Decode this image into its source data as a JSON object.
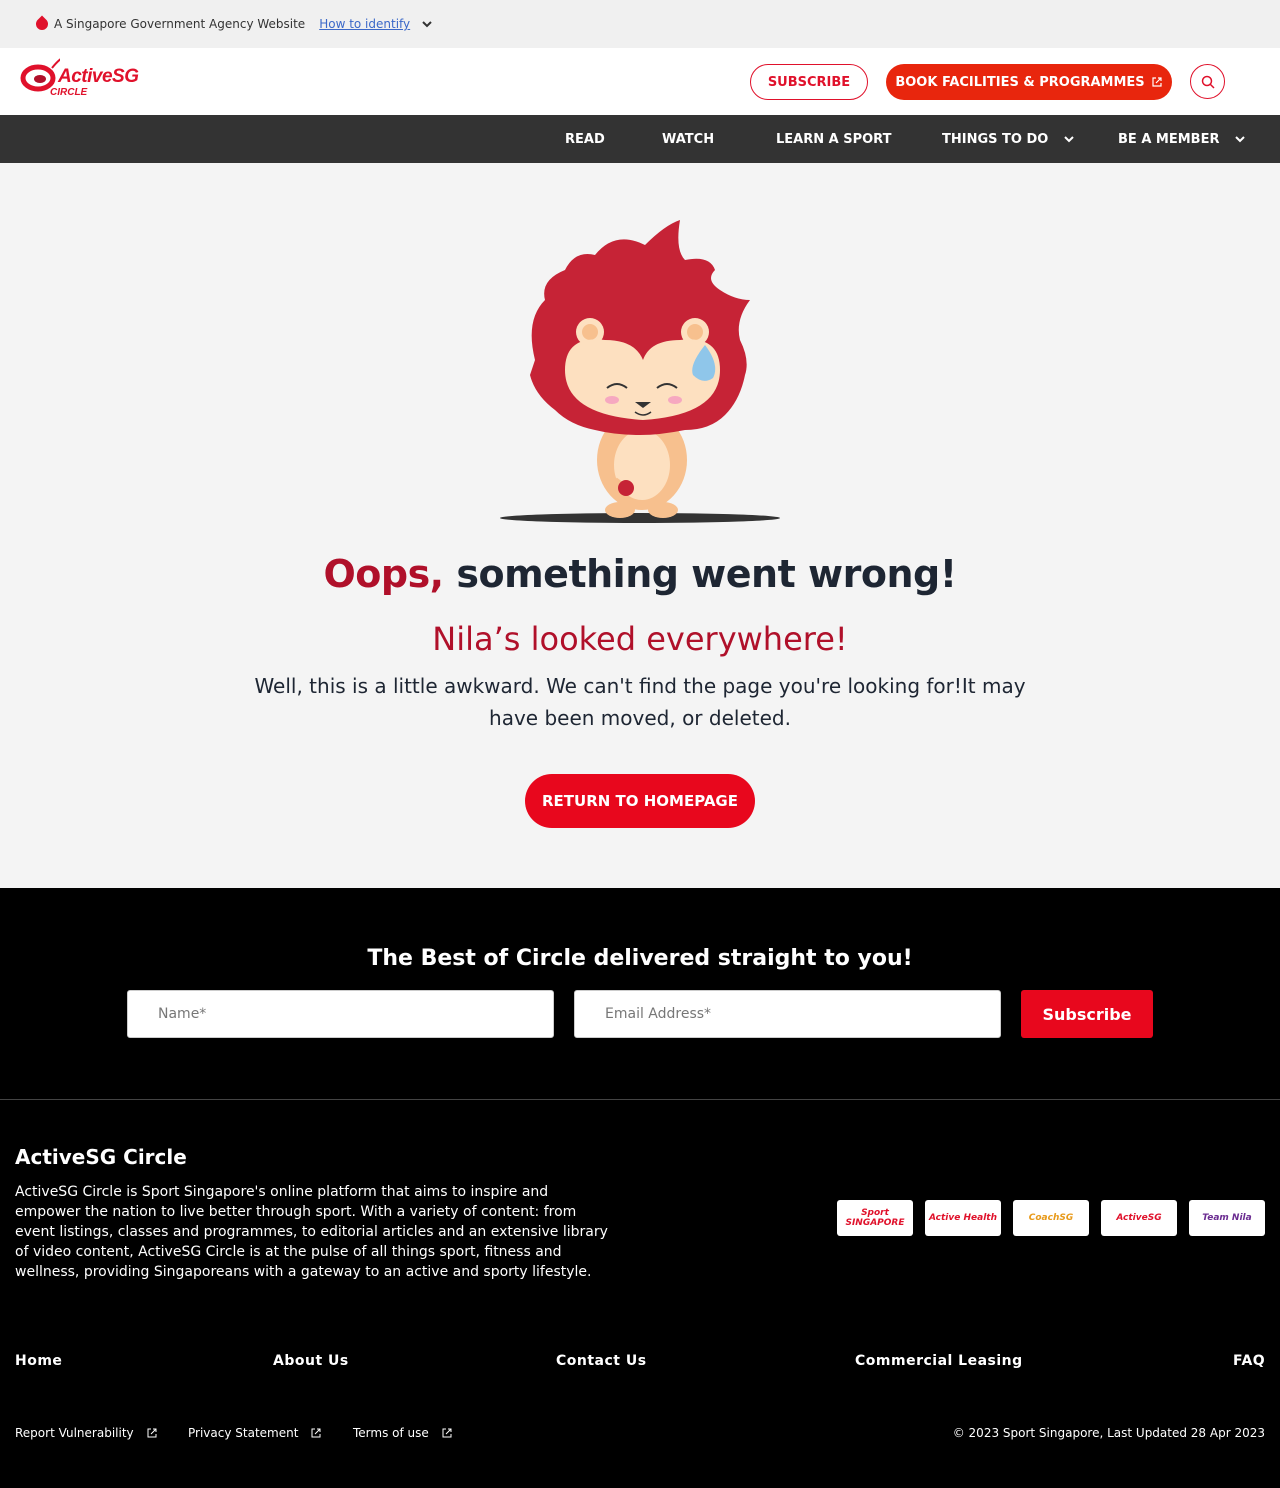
{
  "masthead": {
    "text": "A Singapore Government Agency Website",
    "link": "How to identify"
  },
  "header": {
    "logo_text": "ActiveSG",
    "logo_sub": "CIRCLE",
    "subscribe_label": "SUBSCRIBE",
    "book_label": "BOOK FACILITIES & PROGRAMMES"
  },
  "nav": {
    "items": [
      {
        "label": "READ"
      },
      {
        "label": "WATCH"
      },
      {
        "label": "LEARN A SPORT"
      },
      {
        "label": "THINGS TO DO"
      },
      {
        "label": "BE A MEMBER"
      }
    ]
  },
  "main": {
    "oops": "Oops,",
    "headline": "something went wrong!",
    "subheadline": "Nila’s looked everywhere!",
    "description": "Well, this is a little awkward. We can't find the page you're looking for!It may have been moved, or deleted.",
    "button": "RETURN TO HOMEPAGE"
  },
  "newsletter": {
    "title": "The Best of Circle delivered straight to you!",
    "name_placeholder": "Name*",
    "email_placeholder": "Email Address*",
    "button": "Subscribe"
  },
  "footer": {
    "title": "ActiveSG Circle",
    "description": "ActiveSG Circle is Sport Singapore's online platform that aims to inspire and empower the nation to live better through sport. With a variety of content: from event listings, classes and programmes, to editorial articles and an extensive library of video content, ActiveSG Circle is at the pulse of all things sport, fitness and wellness, providing Singaporeans with a gateway to an active and sporty lifestyle.",
    "partners": [
      "Sport SINGAPORE",
      "Active Health",
      "CoachSG",
      "ActiveSG",
      "Team Nila"
    ],
    "links": [
      "Home",
      "About Us",
      "Contact Us",
      "Commercial Leasing",
      "FAQ"
    ],
    "legal": [
      "Report Vulnerability",
      "Privacy Statement",
      "Terms of use"
    ],
    "copyright": "© 2023 Sport Singapore, Last Updated 28 Apr 2023"
  },
  "colors": {
    "brand_red": "#e0112b",
    "button_red": "#e8071d",
    "nav_bg": "#333333",
    "footer_bg": "#000000"
  }
}
